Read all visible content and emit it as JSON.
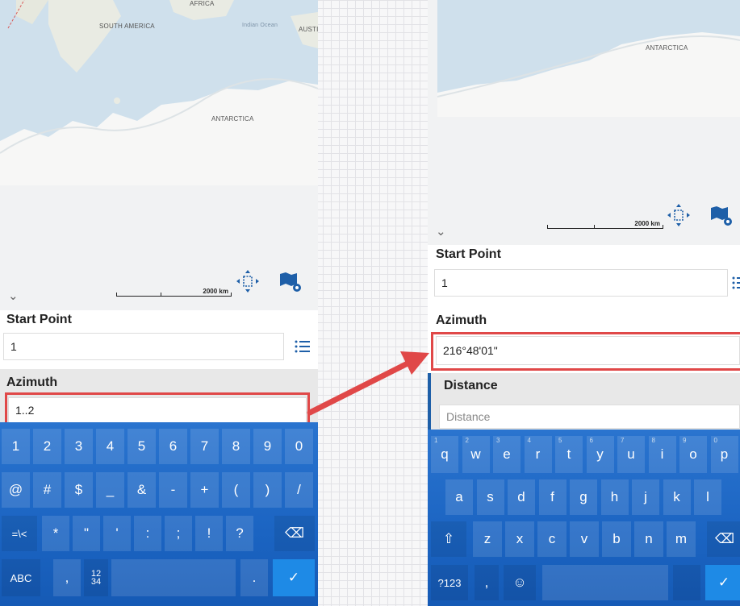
{
  "left": {
    "map": {
      "labels": {
        "africa": "AFRICA",
        "south_america": "SOUTH AMERICA",
        "indian_ocean": "Indian Ocean",
        "australia": "AUSTI",
        "antarctica": "ANTARCTICA"
      },
      "scale_label": "2000 km"
    },
    "start_point": {
      "label": "Start Point",
      "value": "1"
    },
    "azimuth": {
      "label": "Azimuth",
      "value": "1..2"
    },
    "keyboard": {
      "row1": [
        "1",
        "2",
        "3",
        "4",
        "5",
        "6",
        "7",
        "8",
        "9",
        "0"
      ],
      "row2": [
        "@",
        "#",
        "$",
        "_",
        "&",
        "-",
        "+",
        "(",
        ")",
        "/"
      ],
      "row3": [
        "=\\<",
        "*",
        "\"",
        "'",
        ":",
        ";",
        "!",
        "?"
      ],
      "abc": "ABC",
      "comma": ",",
      "fraction": "12\n34",
      "period": "."
    }
  },
  "right": {
    "map": {
      "labels": {
        "antarctica": "ANTARCTICA"
      },
      "scale_label": "2000 km"
    },
    "start_point": {
      "label": "Start Point",
      "value": "1"
    },
    "azimuth": {
      "label": "Azimuth",
      "value": "216°48'01\""
    },
    "distance": {
      "label": "Distance",
      "placeholder": "Distance"
    },
    "keyboard": {
      "row1": [
        {
          "k": "q",
          "s": "1"
        },
        {
          "k": "w",
          "s": "2"
        },
        {
          "k": "e",
          "s": "3"
        },
        {
          "k": "r",
          "s": "4"
        },
        {
          "k": "t",
          "s": "5"
        },
        {
          "k": "y",
          "s": "6"
        },
        {
          "k": "u",
          "s": "7"
        },
        {
          "k": "i",
          "s": "8"
        },
        {
          "k": "o",
          "s": "9"
        },
        {
          "k": "p",
          "s": "0"
        }
      ],
      "row2": [
        "a",
        "s",
        "d",
        "f",
        "g",
        "h",
        "j",
        "k",
        "l"
      ],
      "row3": [
        "z",
        "x",
        "c",
        "v",
        "b",
        "n",
        "m"
      ],
      "sym": "?123",
      "comma": ","
    }
  },
  "colors": {
    "accent": "#1e5fa8",
    "highlight": "#e04848",
    "keyboard": "#1b64c2"
  }
}
